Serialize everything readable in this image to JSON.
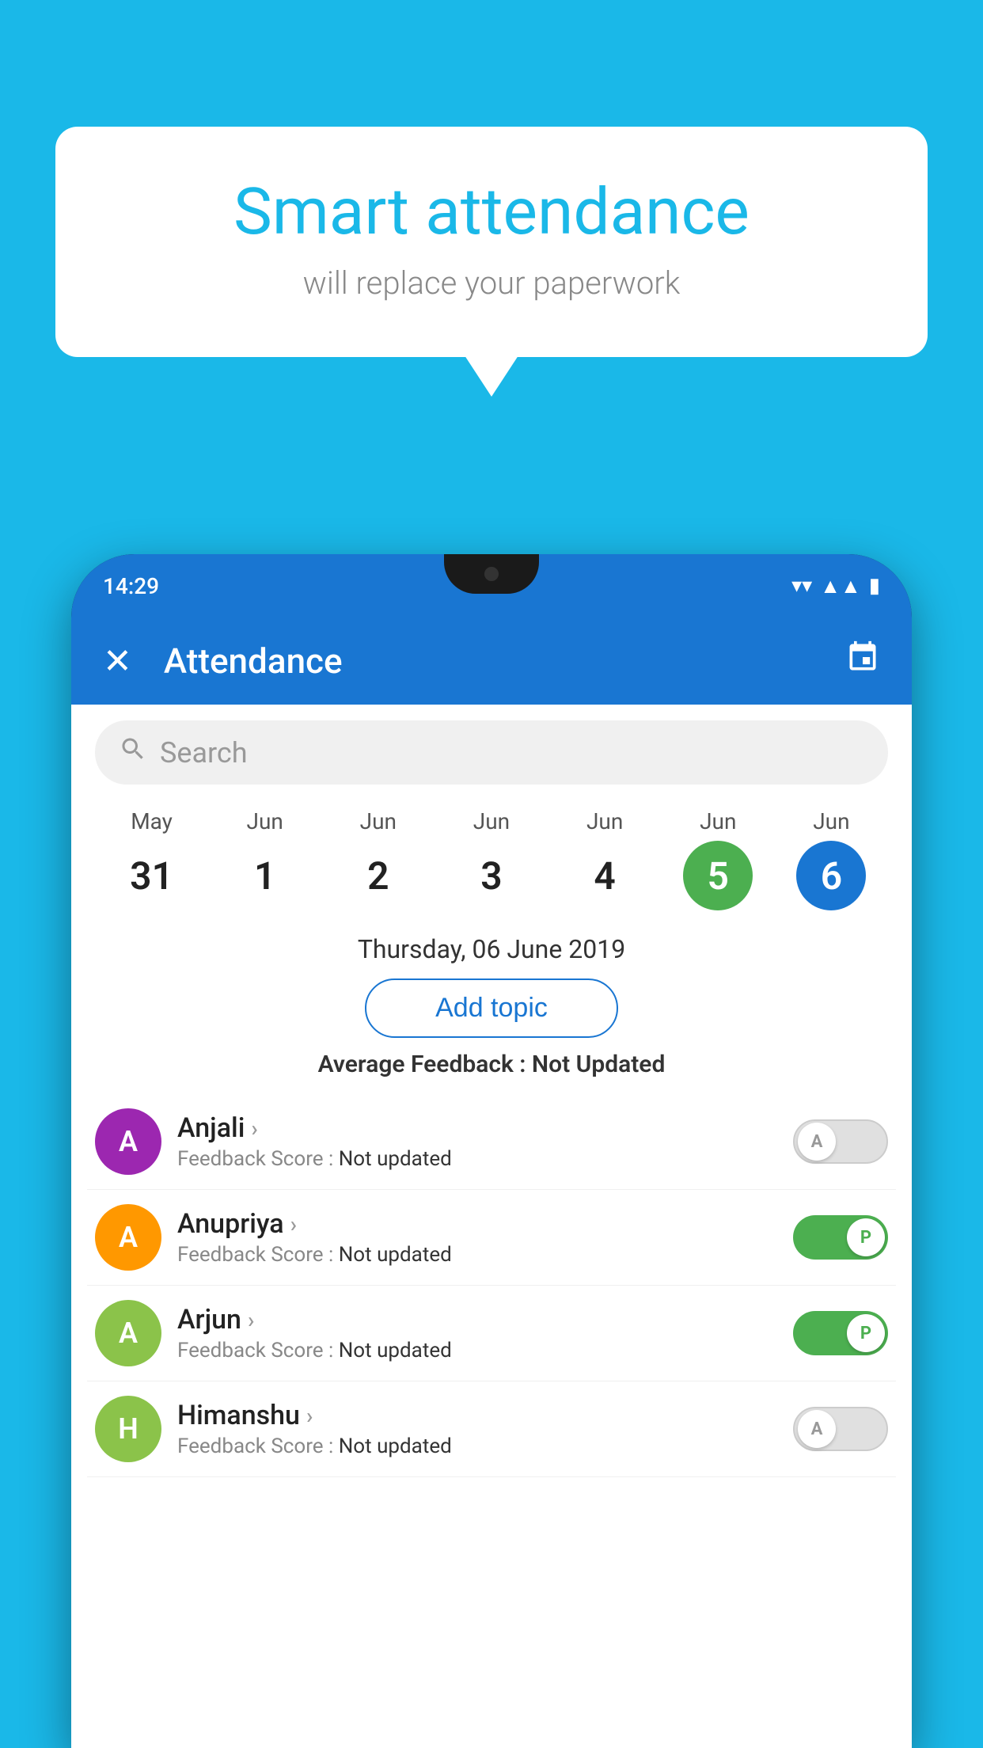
{
  "background_color": "#1ab8e8",
  "bubble": {
    "title": "Smart attendance",
    "subtitle": "will replace your paperwork"
  },
  "phone": {
    "status_bar": {
      "time": "14:29",
      "icons": [
        "wifi",
        "signal",
        "battery"
      ]
    },
    "header": {
      "close_label": "✕",
      "title": "Attendance",
      "calendar_icon": "📅"
    },
    "search": {
      "placeholder": "Search"
    },
    "dates": [
      {
        "month": "May",
        "day": "31",
        "style": "normal"
      },
      {
        "month": "Jun",
        "day": "1",
        "style": "normal"
      },
      {
        "month": "Jun",
        "day": "2",
        "style": "normal"
      },
      {
        "month": "Jun",
        "day": "3",
        "style": "normal"
      },
      {
        "month": "Jun",
        "day": "4",
        "style": "normal"
      },
      {
        "month": "Jun",
        "day": "5",
        "style": "green"
      },
      {
        "month": "Jun",
        "day": "6",
        "style": "blue"
      }
    ],
    "selected_date": "Thursday, 06 June 2019",
    "add_topic_label": "Add topic",
    "average_feedback": {
      "label": "Average Feedback : ",
      "value": "Not Updated"
    },
    "students": [
      {
        "name": "Anjali",
        "initial": "A",
        "avatar_color": "#9c27b0",
        "feedback_label": "Feedback Score : ",
        "feedback_value": "Not updated",
        "toggle": "off",
        "toggle_label": "A"
      },
      {
        "name": "Anupriya",
        "initial": "A",
        "avatar_color": "#ff9800",
        "feedback_label": "Feedback Score : ",
        "feedback_value": "Not updated",
        "toggle": "on",
        "toggle_label": "P"
      },
      {
        "name": "Arjun",
        "initial": "A",
        "avatar_color": "#8bc34a",
        "feedback_label": "Feedback Score : ",
        "feedback_value": "Not updated",
        "toggle": "on",
        "toggle_label": "P"
      },
      {
        "name": "Himanshu",
        "initial": "H",
        "avatar_color": "#8bc34a",
        "feedback_label": "Feedback Score : ",
        "feedback_value": "Not updated",
        "toggle": "off",
        "toggle_label": "A"
      }
    ]
  }
}
